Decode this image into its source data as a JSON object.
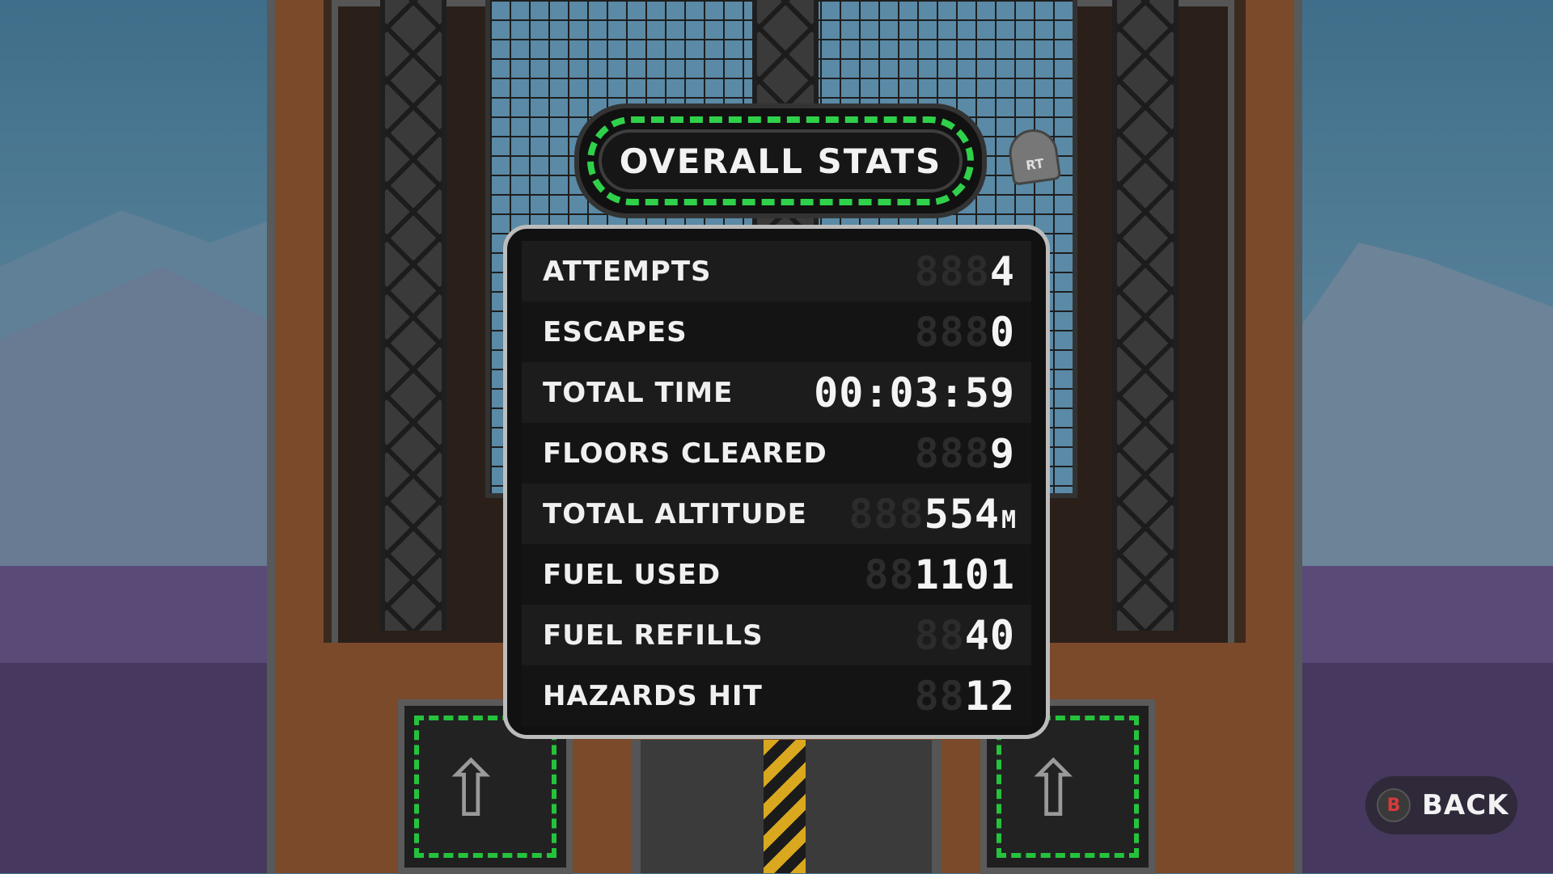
{
  "title": "OVERALL STATS",
  "rt_badge": "RT",
  "stats": [
    {
      "label": "ATTEMPTS",
      "ghost": "888",
      "value": "4",
      "unit": ""
    },
    {
      "label": "ESCAPES",
      "ghost": "888",
      "value": "0",
      "unit": ""
    },
    {
      "label": "TOTAL TIME",
      "ghost": "",
      "value": "00:03:59",
      "unit": ""
    },
    {
      "label": "FLOORS CLEARED",
      "ghost": "888",
      "value": "9",
      "unit": ""
    },
    {
      "label": "TOTAL ALTITUDE",
      "ghost": "888",
      "value": "554",
      "unit": "M"
    },
    {
      "label": "FUEL USED",
      "ghost": "88",
      "value": "1101",
      "unit": ""
    },
    {
      "label": "FUEL REFILLS",
      "ghost": "88",
      "value": "40",
      "unit": ""
    },
    {
      "label": "HAZARDS HIT",
      "ghost": "88",
      "value": "12",
      "unit": ""
    }
  ],
  "back": {
    "button": "B",
    "label": "BACK"
  },
  "pad_icon": "up-arrow-icon",
  "colors": {
    "accent_green": "#2fd14a",
    "back_button": "#d83a3a"
  }
}
